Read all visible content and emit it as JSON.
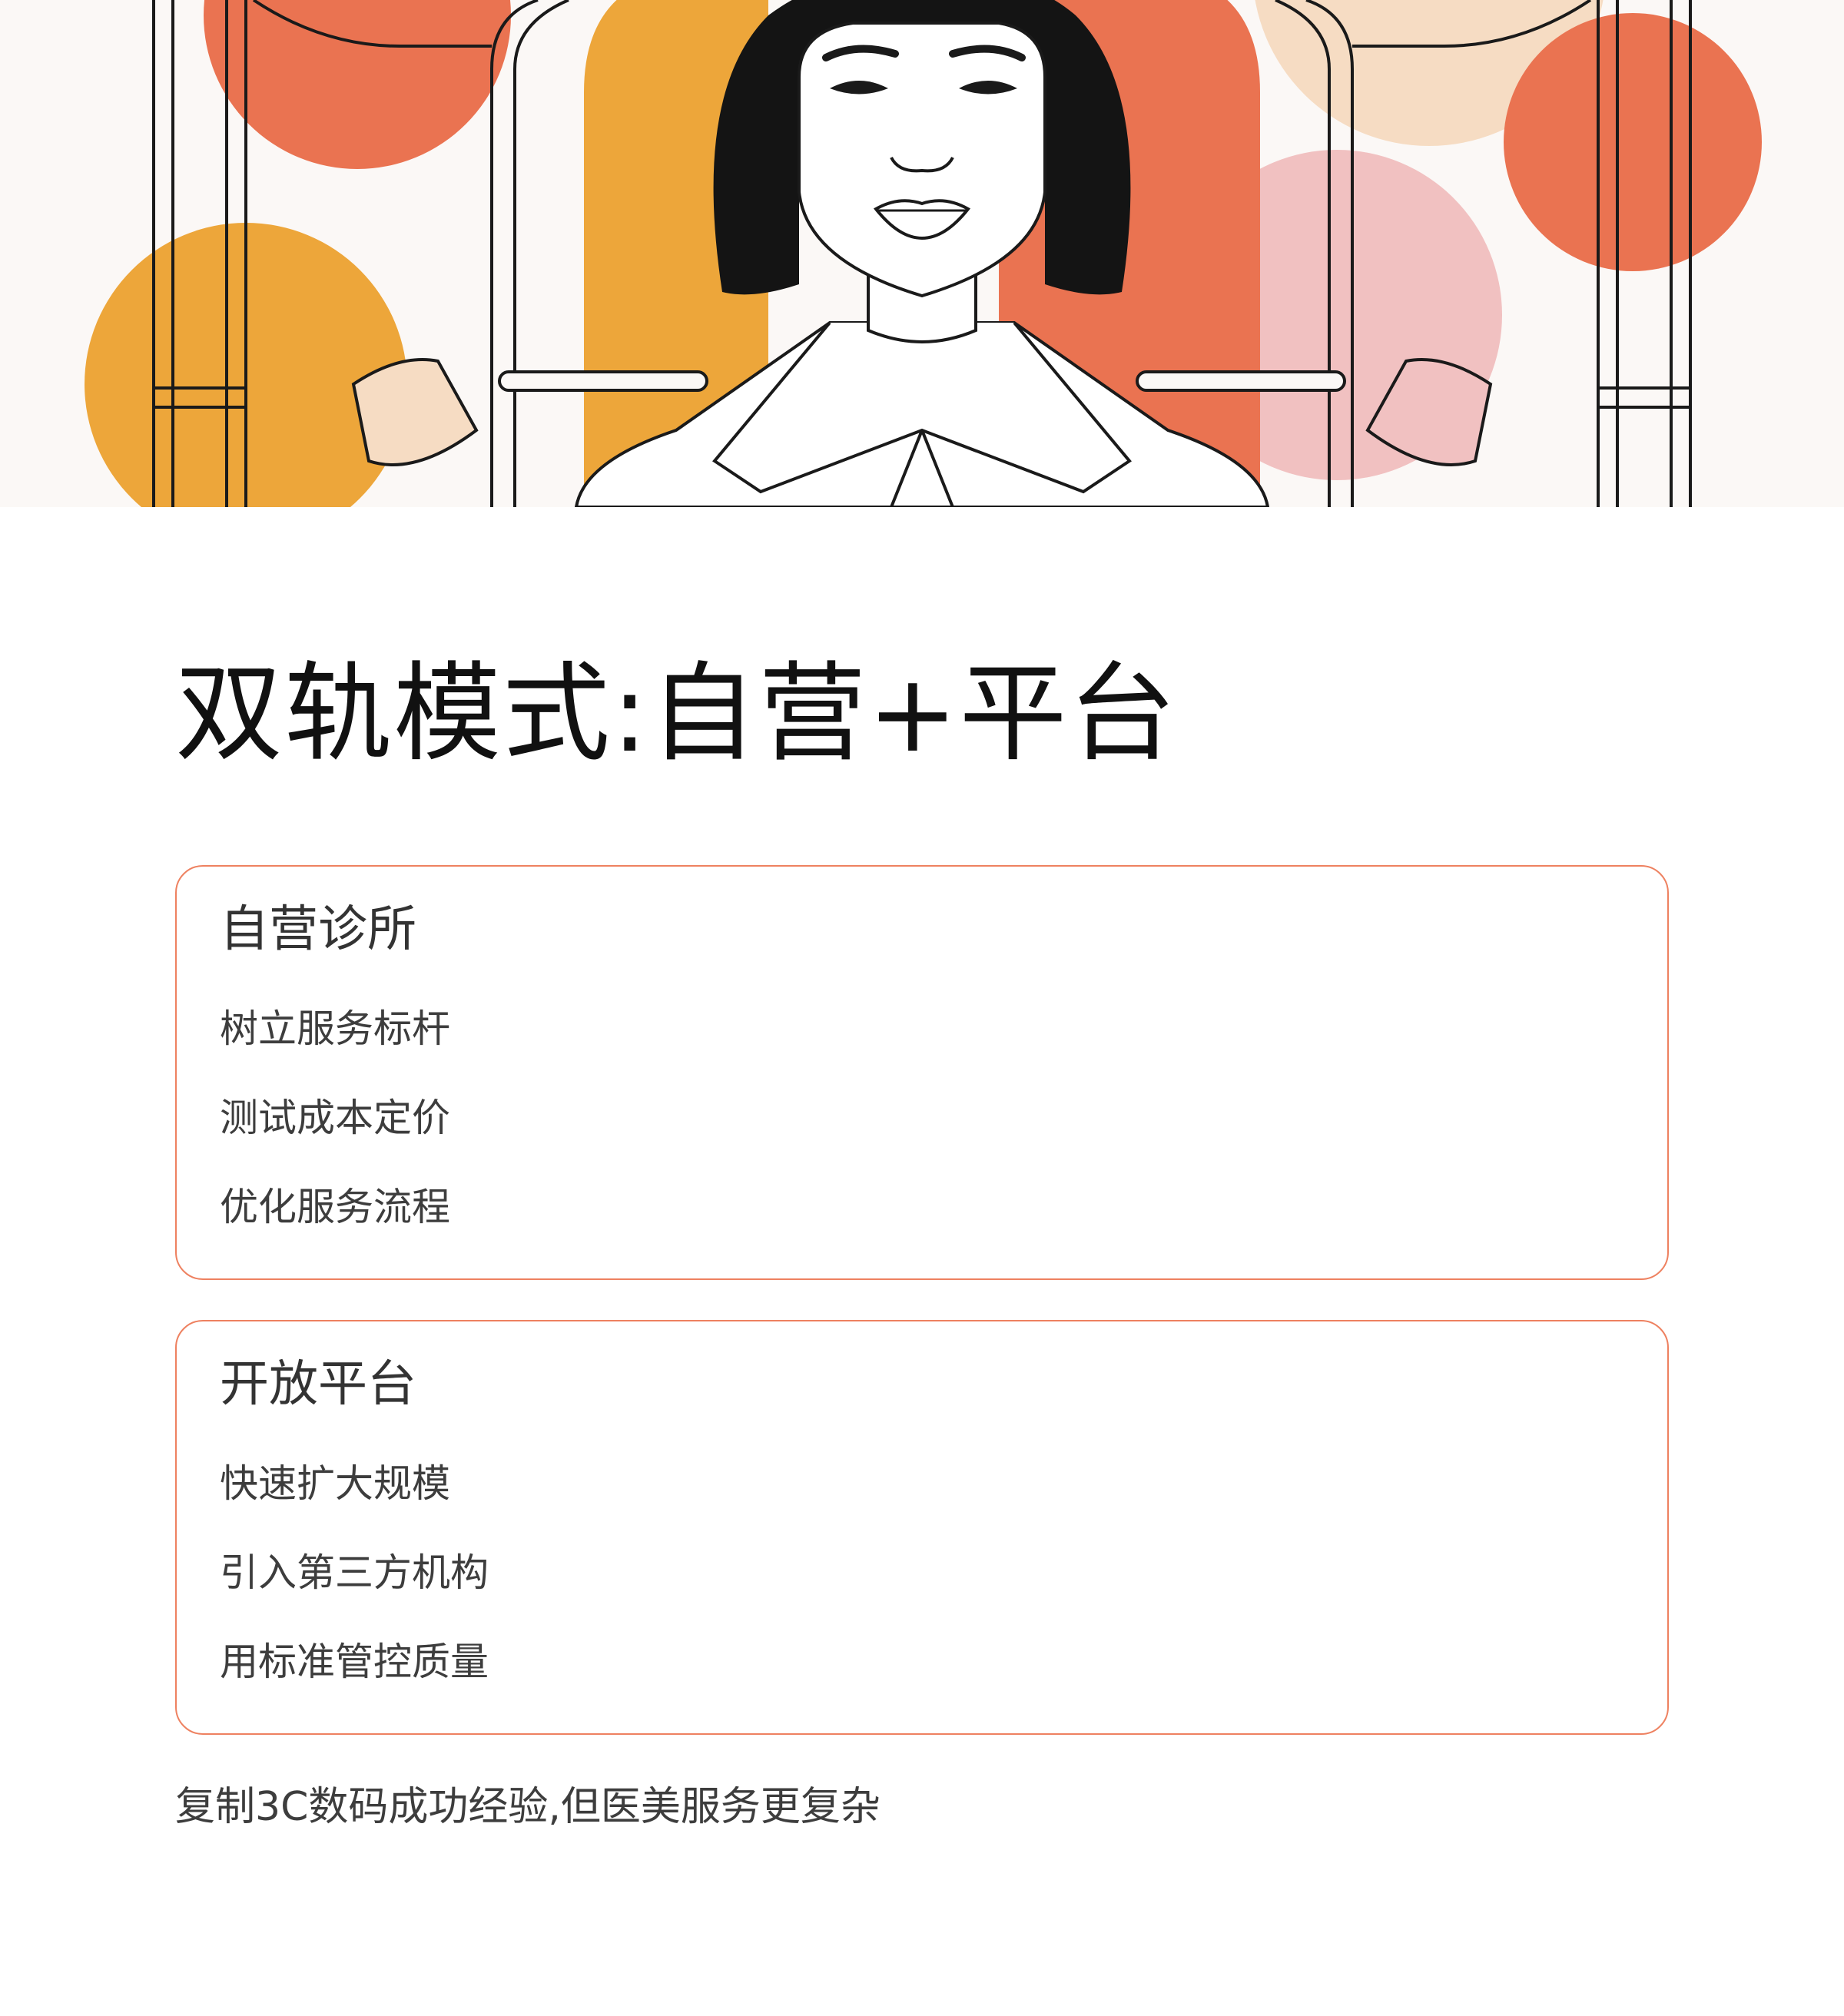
{
  "hero": {
    "illustration": "woman-between-scales-illustration",
    "colors": {
      "orange": "#eda63a",
      "coral": "#ea7351",
      "pink": "#f1c1c1",
      "peach": "#f6dcc3",
      "line": "#1a1a1a"
    }
  },
  "page": {
    "title": "双轨模式:自营+平台",
    "footnote": "复制3C数码成功经验,但医美服务更复杂"
  },
  "cards": [
    {
      "title": "自营诊所",
      "items": [
        "树立服务标杆",
        "测试成本定价",
        "优化服务流程"
      ]
    },
    {
      "title": "开放平台",
      "items": [
        "快速扩大规模",
        "引入第三方机构",
        "用标准管控质量"
      ]
    }
  ],
  "accent_border": "#ee8160"
}
